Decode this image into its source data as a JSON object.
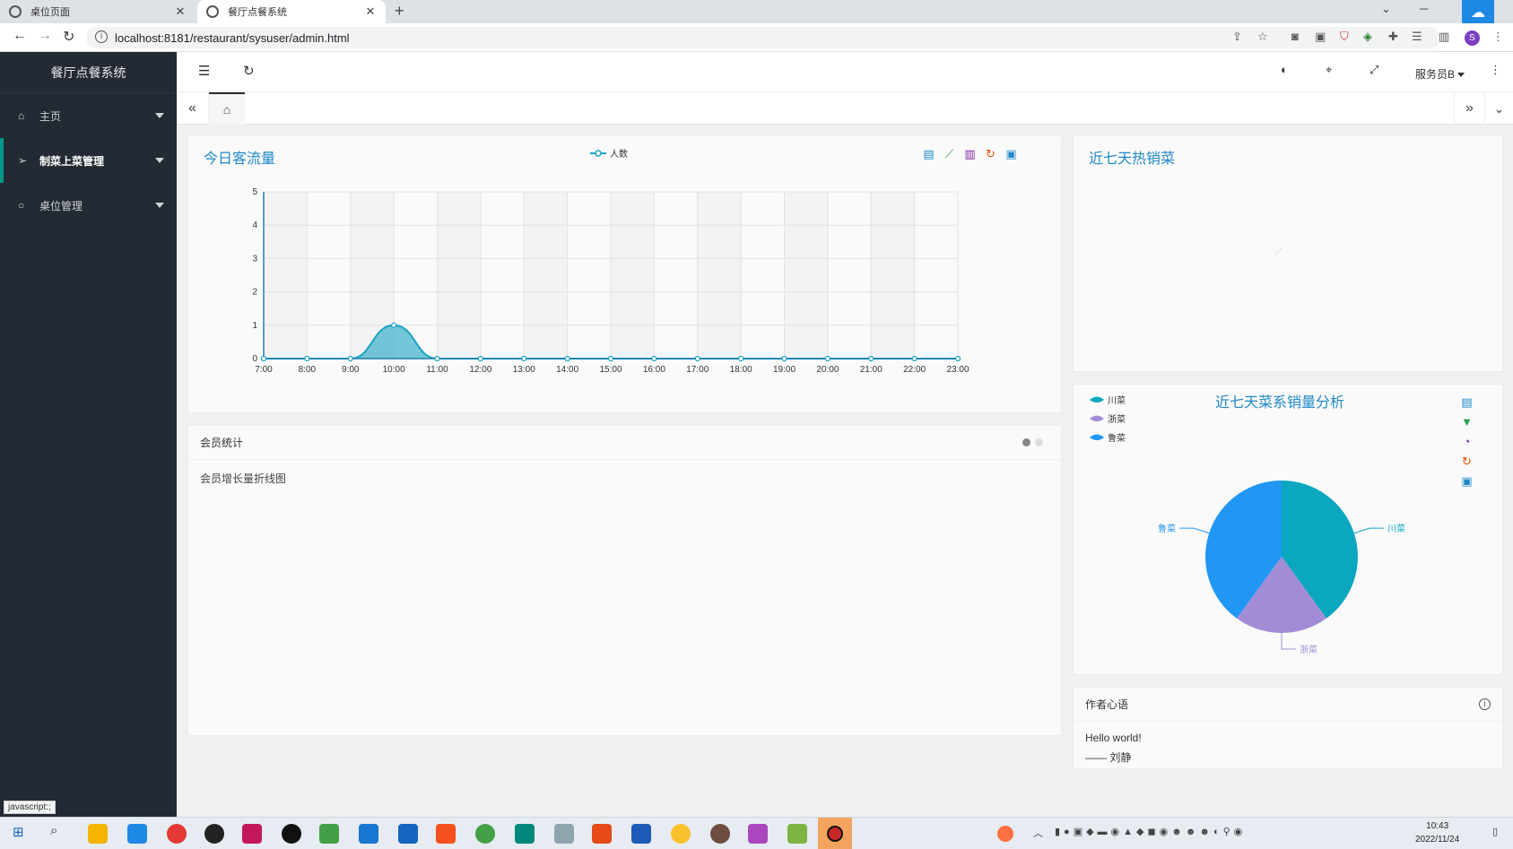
{
  "browser": {
    "tabs": [
      {
        "label": "桌位页面",
        "active": false
      },
      {
        "label": "餐厅点餐系统",
        "active": true
      }
    ],
    "url": "localhost:8181/restaurant/sysuser/admin.html",
    "profile_initial": "S"
  },
  "sidebar": {
    "title": "餐厅点餐系统",
    "items": [
      {
        "label": "主页",
        "icon": "home-icon"
      },
      {
        "label": "制菜上菜管理",
        "icon": "send-icon"
      },
      {
        "label": "桌位管理",
        "icon": "circle-icon"
      }
    ]
  },
  "header": {
    "user": "服务员B"
  },
  "traffic": {
    "title": "今日客流量",
    "legend": "人数",
    "series_color": "#1aa3c1"
  },
  "hot_dishes": {
    "title": "近七天热销菜"
  },
  "members": {
    "title": "会员统计",
    "subtitle": "会员增长量折线图"
  },
  "cuisine": {
    "title": "近七天菜系销量分析"
  },
  "author": {
    "title": "作者心语",
    "line1": "Hello world!",
    "line2": "—— 刘静"
  },
  "status_url": "javascript:;",
  "taskbar": {
    "time": "10:43",
    "date": "2022/11/24"
  },
  "chart_data": [
    {
      "type": "area",
      "title": "今日客流量",
      "legend": [
        "人数"
      ],
      "x": [
        "7:00",
        "8:00",
        "9:00",
        "10:00",
        "11:00",
        "12:00",
        "13:00",
        "14:00",
        "15:00",
        "16:00",
        "17:00",
        "18:00",
        "19:00",
        "20:00",
        "21:00",
        "22:00",
        "23:00"
      ],
      "series": [
        {
          "name": "人数",
          "values": [
            0,
            0,
            0,
            1,
            0,
            0,
            0,
            0,
            0,
            0,
            0,
            0,
            0,
            0,
            0,
            0,
            0
          ]
        }
      ],
      "ylim": [
        0,
        5
      ],
      "yticks": [
        0,
        1,
        2,
        3,
        4,
        5
      ],
      "grid": true,
      "smooth": true,
      "color": "#1aa3c1"
    },
    {
      "type": "pie",
      "title": "近七天菜系销量分析",
      "legend": [
        "川菜",
        "浙菜",
        "鲁菜"
      ],
      "legend_position": "top-left",
      "labels": [
        "川菜",
        "浙菜",
        "鲁菜"
      ],
      "values": [
        40,
        20,
        40
      ],
      "colors": [
        "#0aa7bf",
        "#a38cd6",
        "#2196f3"
      ]
    }
  ]
}
